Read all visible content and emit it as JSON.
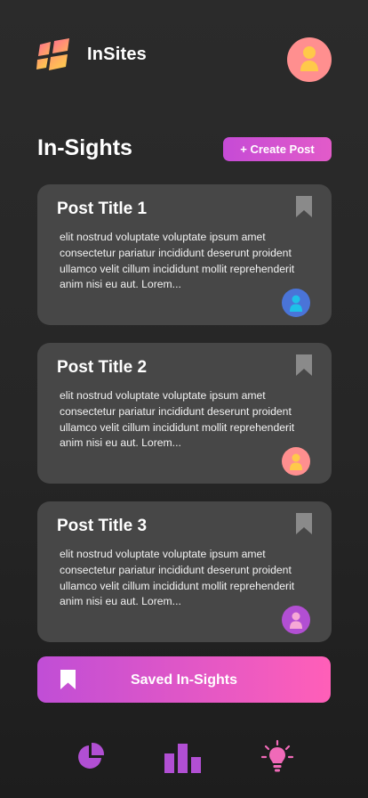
{
  "app": {
    "name": "InSites"
  },
  "colors": {
    "accent_start": "#c64bd6",
    "accent_end": "#ff5fb8",
    "card_bg": "#474747",
    "icon_gray": "#8a8a8a",
    "nav_icon": "#b14fd3"
  },
  "main": {
    "title": "In-Sights",
    "create_button": "+ Create Post",
    "saved_button": "Saved In-Sights"
  },
  "posts": [
    {
      "title": "Post Title 1",
      "body": "elit nostrud voluptate voluptate ipsum amet consectetur pariatur incididunt deserunt proident ullamco velit cillum incididunt mollit reprehenderit anim nisi eu aut. Lorem...",
      "avatar_color": "#4a74d8",
      "avatar_figure": "#1fc0e8"
    },
    {
      "title": "Post Title 2",
      "body": "elit nostrud voluptate voluptate ipsum amet consectetur pariatur incididunt deserunt proident ullamco velit cillum incididunt mollit reprehenderit anim nisi eu aut. Lorem...",
      "avatar_color": "#ff8f8f",
      "avatar_figure": "#ffc94a"
    },
    {
      "title": "Post Title 3",
      "body": "elit nostrud voluptate voluptate ipsum amet consectetur pariatur incididunt deserunt proident ullamco velit cillum incididunt mollit reprehenderit anim nisi eu aut. Lorem...",
      "avatar_color": "#b24fd3",
      "avatar_figure": "#f6a8d6"
    }
  ],
  "nav": {
    "items": [
      {
        "icon": "pie-chart-icon"
      },
      {
        "icon": "bar-chart-icon"
      },
      {
        "icon": "lightbulb-icon"
      }
    ]
  }
}
